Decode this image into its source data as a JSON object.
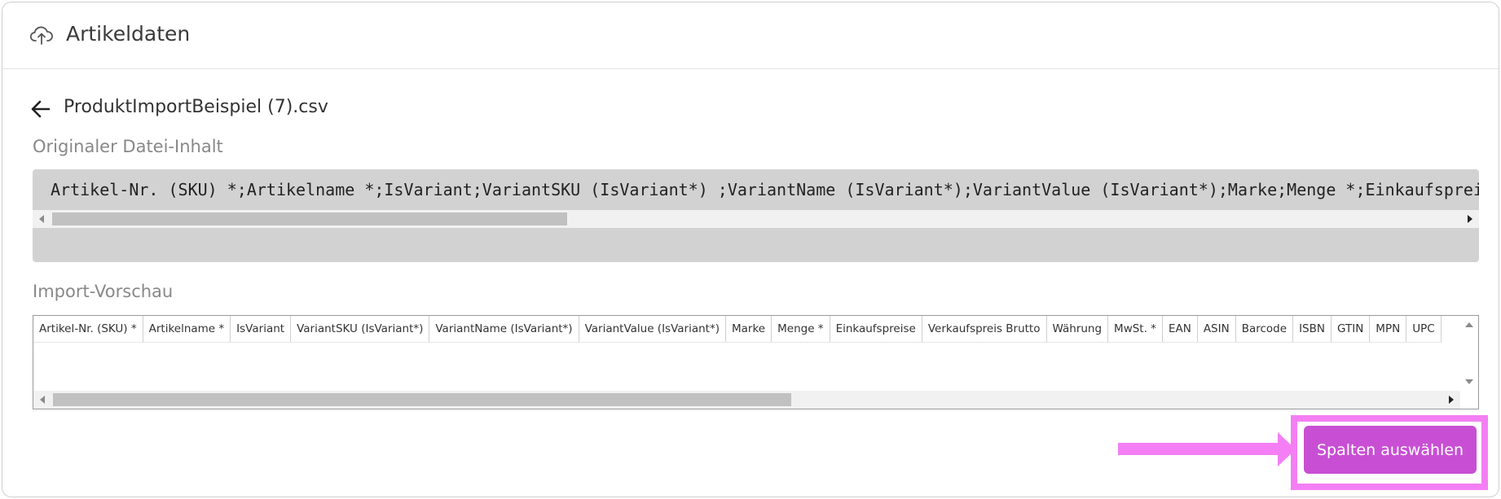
{
  "card": {
    "title": "Artikeldaten",
    "icon": "cloud-upload-icon"
  },
  "file": {
    "name": "ProduktImportBeispiel (7).csv",
    "back_icon": "arrow-left-icon"
  },
  "original": {
    "label": "Originaler Datei-Inhalt",
    "raw_text": "Artikel-Nr. (SKU) *;Artikelname *;IsVariant;VariantSKU (IsVariant*) ;VariantName (IsVariant*);VariantValue (IsVariant*);Marke;Menge *;Einkaufspreise"
  },
  "preview": {
    "label": "Import-Vorschau",
    "columns": [
      "Artikel-Nr. (SKU) *",
      "Artikelname *",
      "IsVariant",
      "VariantSKU (IsVariant*)",
      "VariantName (IsVariant*)",
      "VariantValue (IsVariant*)",
      "Marke",
      "Menge *",
      "Einkaufspreise",
      "Verkaufspreis Brutto",
      "Währung",
      "MwSt. *",
      "EAN",
      "ASIN",
      "Barcode",
      "ISBN",
      "GTIN",
      "MPN",
      "UPC"
    ]
  },
  "actions": {
    "select_columns_label": "Spalten auswählen"
  },
  "colors": {
    "accent": "#c84fd4",
    "highlight": "#f47ff4",
    "raw_bg": "#d2d2d2"
  }
}
